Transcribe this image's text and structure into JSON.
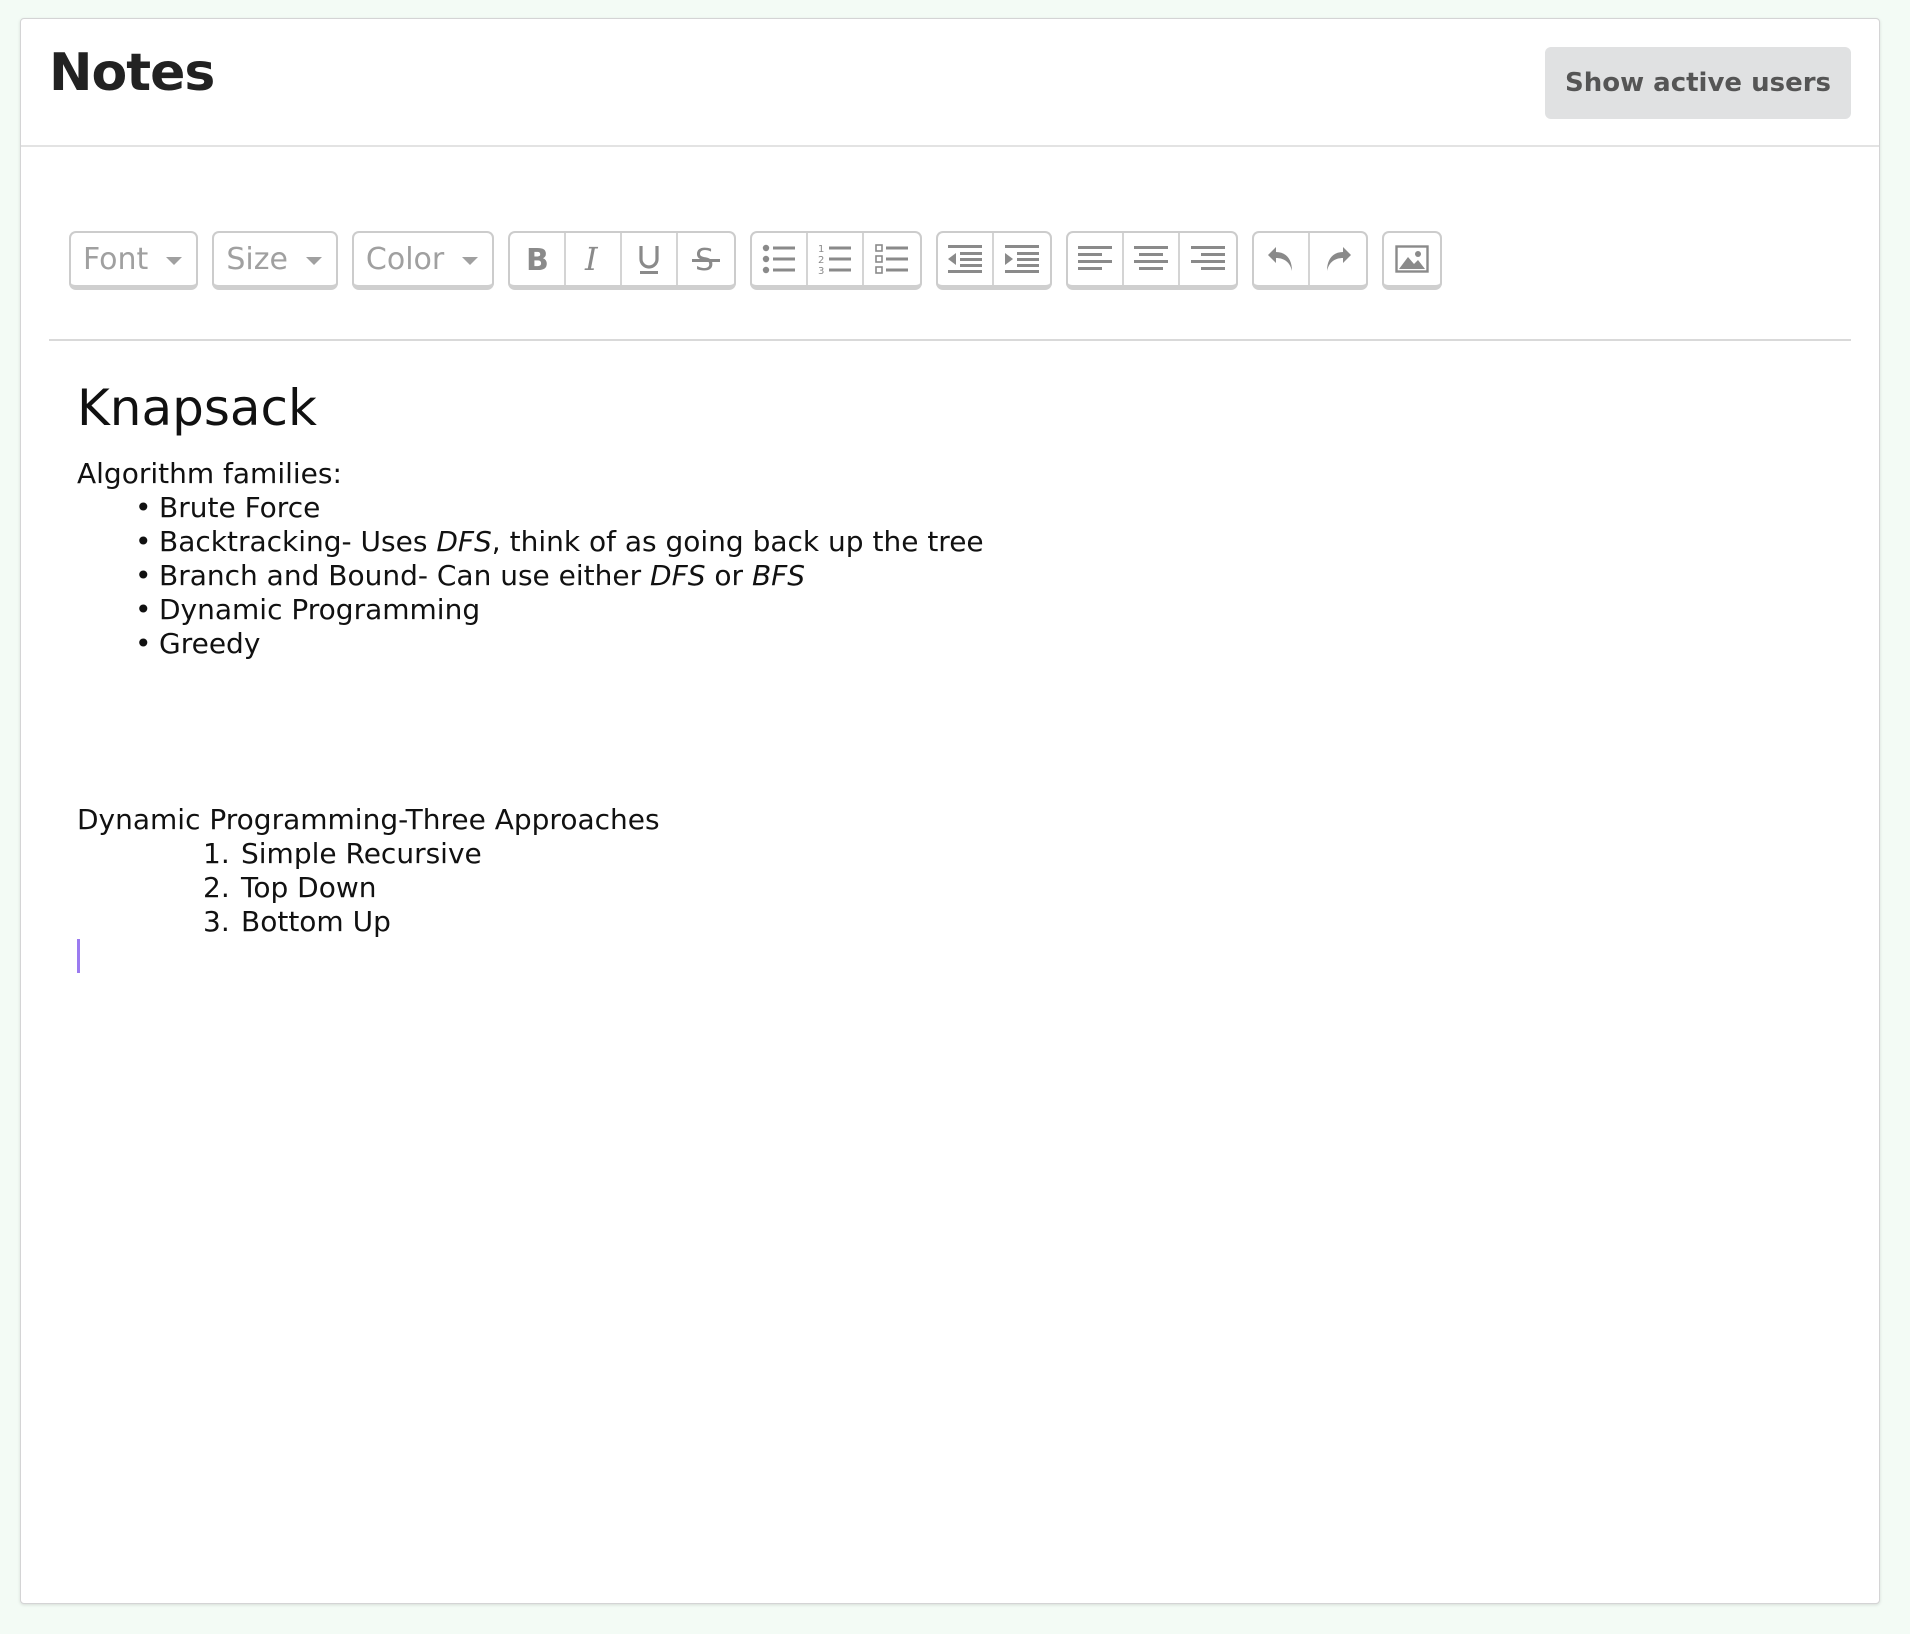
{
  "header": {
    "title": "Notes",
    "active_users_label": "Show active users"
  },
  "toolbar": {
    "font_label": "Font",
    "size_label": "Size",
    "color_label": "Color",
    "icons": {
      "format": [
        "bold-icon",
        "italic-icon",
        "underline-icon",
        "strikethrough-icon"
      ],
      "lists": [
        "bullet-list-icon",
        "numbered-list-icon",
        "checklist-icon"
      ],
      "indent": [
        "outdent-icon",
        "indent-icon"
      ],
      "align": [
        "align-left-icon",
        "align-center-icon",
        "align-right-icon"
      ],
      "history": [
        "undo-icon",
        "redo-icon"
      ],
      "insert": [
        "image-icon"
      ]
    }
  },
  "document": {
    "heading": "Knapsack",
    "families_intro": "Algorithm families:",
    "families": [
      {
        "text": "Brute Force"
      },
      {
        "pre": "Backtracking- Uses ",
        "em1": "DFS",
        "post": ", think of as going back up the tree"
      },
      {
        "pre": "Branch and Bound- Can use either ",
        "em1": "DFS",
        "mid": " or ",
        "em2": "BFS"
      },
      {
        "text": "Dynamic Programming"
      },
      {
        "text": "Greedy"
      }
    ],
    "dp_intro": "Dynamic Programming-Three Approaches",
    "approaches": [
      {
        "num": "1.",
        "text": "Simple Recursive"
      },
      {
        "num": "2.",
        "text": "Top Down"
      },
      {
        "num": "3.",
        "text": "Bottom Up"
      }
    ]
  },
  "colors": {
    "cursor": "#9b7bf0",
    "button_bg": "#e0e1e2",
    "page_bg": "#f3fbf5"
  }
}
